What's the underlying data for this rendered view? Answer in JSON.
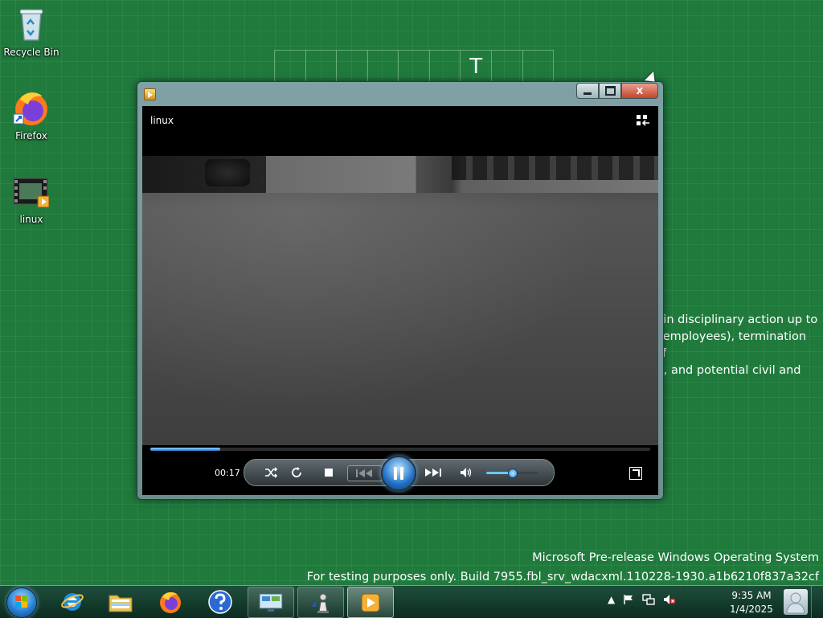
{
  "desktop": {
    "icons": [
      {
        "label": "Recycle Bin"
      },
      {
        "label": "Firefox"
      },
      {
        "label": "linux"
      }
    ],
    "ghost_widget_letter": "T",
    "background_text": [
      "t in disciplinary action up to",
      "f employees), termination of",
      "f), and potential civil and"
    ],
    "watermark": {
      "line1": "Microsoft Pre-release Windows Operating System",
      "line2": "For testing purposes only. Build 7955.fbl_srv_wdacxml.110228-1930.a1b6210f837a32cf"
    }
  },
  "player": {
    "video_title": "linux",
    "time": "00:17",
    "progress": 0.14,
    "volume": 0.5,
    "caption_close": "X"
  },
  "taskbar": {
    "clock_time": "9:35 AM",
    "clock_date": "1/4/2025"
  },
  "colors": {
    "desktop": "#1f7a3c",
    "accent_blue": "#2a78c8"
  }
}
